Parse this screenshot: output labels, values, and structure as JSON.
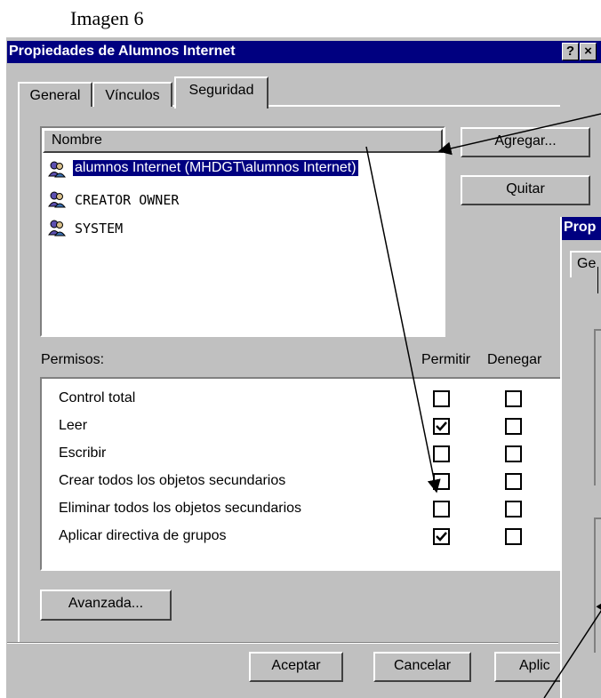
{
  "caption": "Imagen 6",
  "window": {
    "title": "Propiedades de Alumnos Internet",
    "help_glyph": "?",
    "close_glyph": "×"
  },
  "tabs": [
    {
      "label": "General",
      "active": false
    },
    {
      "label": "Vínculos",
      "active": false
    },
    {
      "label": "Seguridad",
      "active": true
    }
  ],
  "names_list": {
    "header": "Nombre",
    "items": [
      {
        "label": "alumnos Internet (MHDGT\\alumnos Internet)",
        "selected": true
      },
      {
        "label": "CREATOR OWNER",
        "selected": false
      },
      {
        "label": "SYSTEM",
        "selected": false
      }
    ]
  },
  "buttons": {
    "add": "Agregar...",
    "remove": "Quitar",
    "advanced": "Avanzada...",
    "ok": "Aceptar",
    "cancel": "Cancelar",
    "apply": "Aplic"
  },
  "permissions": {
    "label": "Permisos:",
    "col_allow": "Permitir",
    "col_deny": "Denegar",
    "rows": [
      {
        "name": "Control total",
        "allow": false,
        "deny": false
      },
      {
        "name": "Leer",
        "allow": true,
        "deny": false
      },
      {
        "name": "Escribir",
        "allow": false,
        "deny": false
      },
      {
        "name": "Crear todos los objetos secundarios",
        "allow": false,
        "deny": false
      },
      {
        "name": "Eliminar todos los objetos secundarios",
        "allow": false,
        "deny": false
      },
      {
        "name": "Aplicar directiva de grupos",
        "allow": true,
        "deny": false
      }
    ]
  },
  "overlay_window": {
    "title": "Prop",
    "tab": "Ge"
  },
  "colors": {
    "titlebar": "#000080",
    "face": "#c0c0c0",
    "selection": "#000080"
  }
}
